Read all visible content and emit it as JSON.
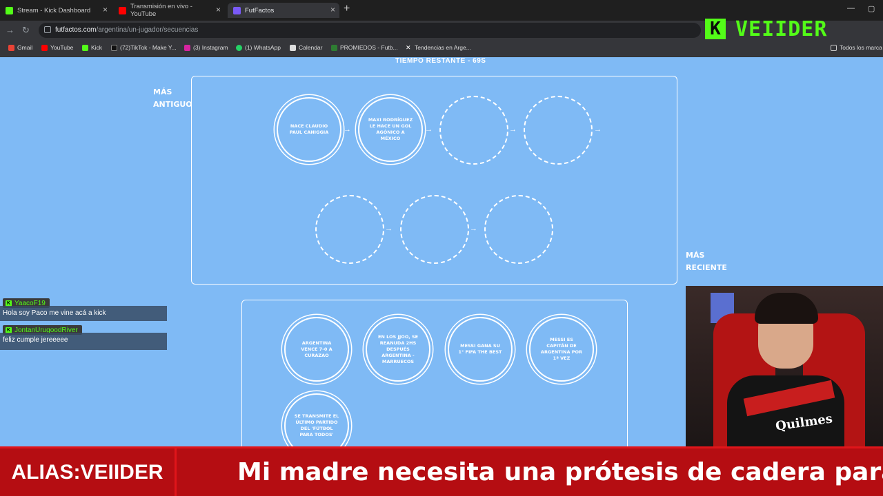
{
  "browser": {
    "tabs": [
      {
        "title": "Stream - Kick Dashboard",
        "favicon": "#53fc18"
      },
      {
        "title": "Transmisión en vivo - YouTube",
        "favicon": "#ff0000"
      },
      {
        "title": "FutFactos",
        "favicon": "#7a5af8"
      }
    ],
    "url_host": "futfactos.com",
    "url_path": "/argentina/un-jugador/secuencias",
    "bookmarks": [
      {
        "label": "Gmail",
        "color": "#ea4335"
      },
      {
        "label": "YouTube",
        "color": "#ff0000"
      },
      {
        "label": "Kick",
        "color": "#53fc18"
      },
      {
        "label": "(72)TikTok - Make Y...",
        "color": "#111111"
      },
      {
        "label": "(3) Instagram",
        "color": "#d6249f"
      },
      {
        "label": "(1) WhatsApp",
        "color": "#25d366"
      },
      {
        "label": "Calendar",
        "color": "#dddddd"
      },
      {
        "label": "PROMIEDOS - Futb...",
        "color": "#2e7d32"
      },
      {
        "label": "Tendencias en Arge...",
        "color": "#ffffff"
      },
      {
        "label": "Todos los marca",
        "color": "#cccccc"
      }
    ]
  },
  "game": {
    "timer": "TIEMPO RESTANTE - 69S",
    "oldest_label": "MÁS ANTIGUO",
    "newest_label": "MÁS RECIENTE",
    "slots_row1": [
      "NACE CLAUDIO PAUL CANIGGIA",
      "MAXI RODRÍGUEZ LE HACE UN GOL AGÓNICO A MÉXICO",
      "",
      ""
    ],
    "slots_row2": [
      "",
      "",
      ""
    ],
    "options": [
      "ARGENTINA VENCE 7-0 A CURAZAO",
      "EN LOS JJOO, SE REANUDA 2HS DESPUÉS ARGENTINA - MARRUECOS",
      "MESSI GANA SU 1° FIFA THE BEST",
      "MESSI ES CAPITÁN DE ARGENTINA POR 1ª VEZ",
      "SE TRANSMITE EL ÚLTIMO PARTIDO DEL 'FÚTBOL PARA TODOS'"
    ]
  },
  "chat": [
    {
      "user": "YaacoF19",
      "text": "Hola soy Paco me vine acá a kick"
    },
    {
      "user": "JontanUrugoodRiver",
      "text": "feliz cumple jereeeee"
    }
  ],
  "overlay": {
    "logo_text": "VEIIDER",
    "logo_letter": "K",
    "alias": "ALIAS:VEIIDER",
    "ticker": "Mi madre necesita una prótesis de cadera para camin",
    "jersey_brand": "Quilmes"
  }
}
